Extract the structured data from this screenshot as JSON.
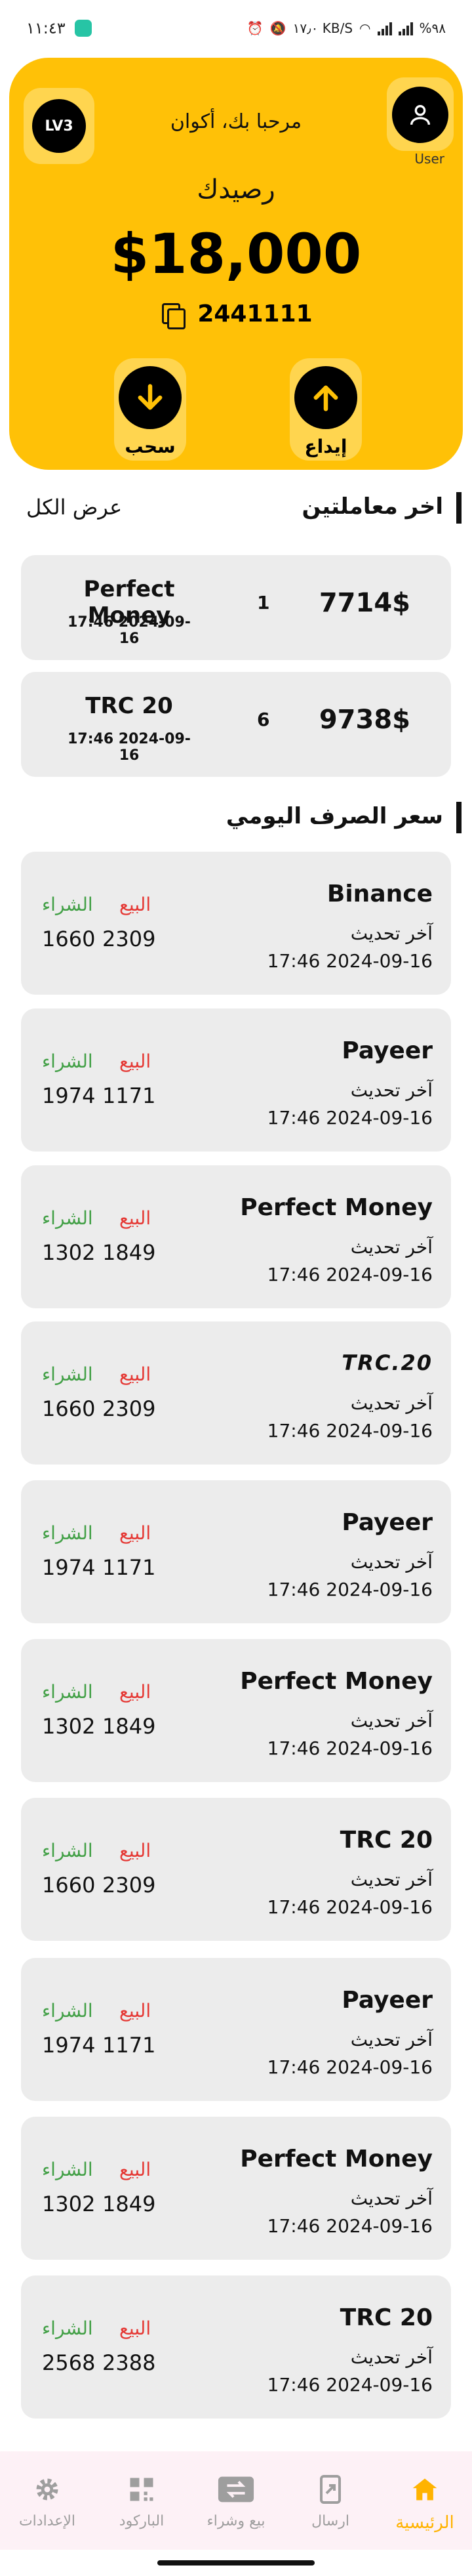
{
  "status_bar": {
    "time": "١١:٤٣",
    "battery": "%٩٨",
    "speed": "١٧٫٠ KB/S"
  },
  "header": {
    "level_badge": "LV3",
    "welcome": "مرحبا بك، أكوان",
    "user_label": "User",
    "balance_label": "رصيدك",
    "balance_amount": "$18,000",
    "account_number": "2441111",
    "withdraw_label": "سحب",
    "deposit_label": "إيداع"
  },
  "transactions_section": {
    "title": "اخر معاملتين",
    "view_all": "عرض الكل",
    "items": [
      {
        "method": "Perfect Money",
        "date": "17:46 2024-09-16",
        "count": "1",
        "amount": "7714$"
      },
      {
        "method": "TRC 20",
        "date": "17:46 2024-09-16",
        "count": "6",
        "amount": "9738$"
      }
    ]
  },
  "rates_section": {
    "title": "سعر الصرف اليومي",
    "last_update_label": "آخر تحديث",
    "sell_label": "البيع",
    "buy_label": "الشراء",
    "items": [
      {
        "name": "Binance",
        "date": "17:46 2024-09-16",
        "sell": "2309",
        "buy": "1660"
      },
      {
        "name": "Payeer",
        "date": "17:46 2024-09-16",
        "sell": "1171",
        "buy": "1974"
      },
      {
        "name": "Perfect Money",
        "date": "17:46 2024-09-16",
        "sell": "1849",
        "buy": "1302"
      },
      {
        "name": "TRC 20",
        "logo_text": "TRC.20",
        "date": "17:46 2024-09-16",
        "sell": "2309",
        "buy": "1660"
      },
      {
        "name": "Payeer",
        "date": "17:46 2024-09-16",
        "sell": "1171",
        "buy": "1974"
      },
      {
        "name": "Perfect Money",
        "date": "17:46 2024-09-16",
        "sell": "1849",
        "buy": "1302"
      },
      {
        "name": "TRC 20",
        "date": "17:46 2024-09-16",
        "sell": "2309",
        "buy": "1660"
      },
      {
        "name": "Payeer",
        "date": "17:46 2024-09-16",
        "sell": "1171",
        "buy": "1974"
      },
      {
        "name": "Perfect Money",
        "date": "17:46 2024-09-16",
        "sell": "1849",
        "buy": "1302"
      },
      {
        "name": "TRC 20",
        "date": "17:46 2024-09-16",
        "sell": "2388",
        "buy": "2568"
      }
    ]
  },
  "bottom_nav": {
    "items": [
      {
        "label": "الرئيسية",
        "icon": "home-icon",
        "active": true
      },
      {
        "label": "ارسال",
        "icon": "send-icon",
        "active": false
      },
      {
        "label": "بيع وشراء",
        "icon": "exchange-icon",
        "active": false
      },
      {
        "label": "الباركود",
        "icon": "qr-code-icon",
        "active": false
      },
      {
        "label": "الإعدادات",
        "icon": "gear-icon",
        "active": false
      }
    ]
  },
  "colors": {
    "primary": "#ffc107",
    "sell": "#e53935",
    "buy": "#43a047",
    "card": "#ececec",
    "nav_active": "#ffb300"
  }
}
